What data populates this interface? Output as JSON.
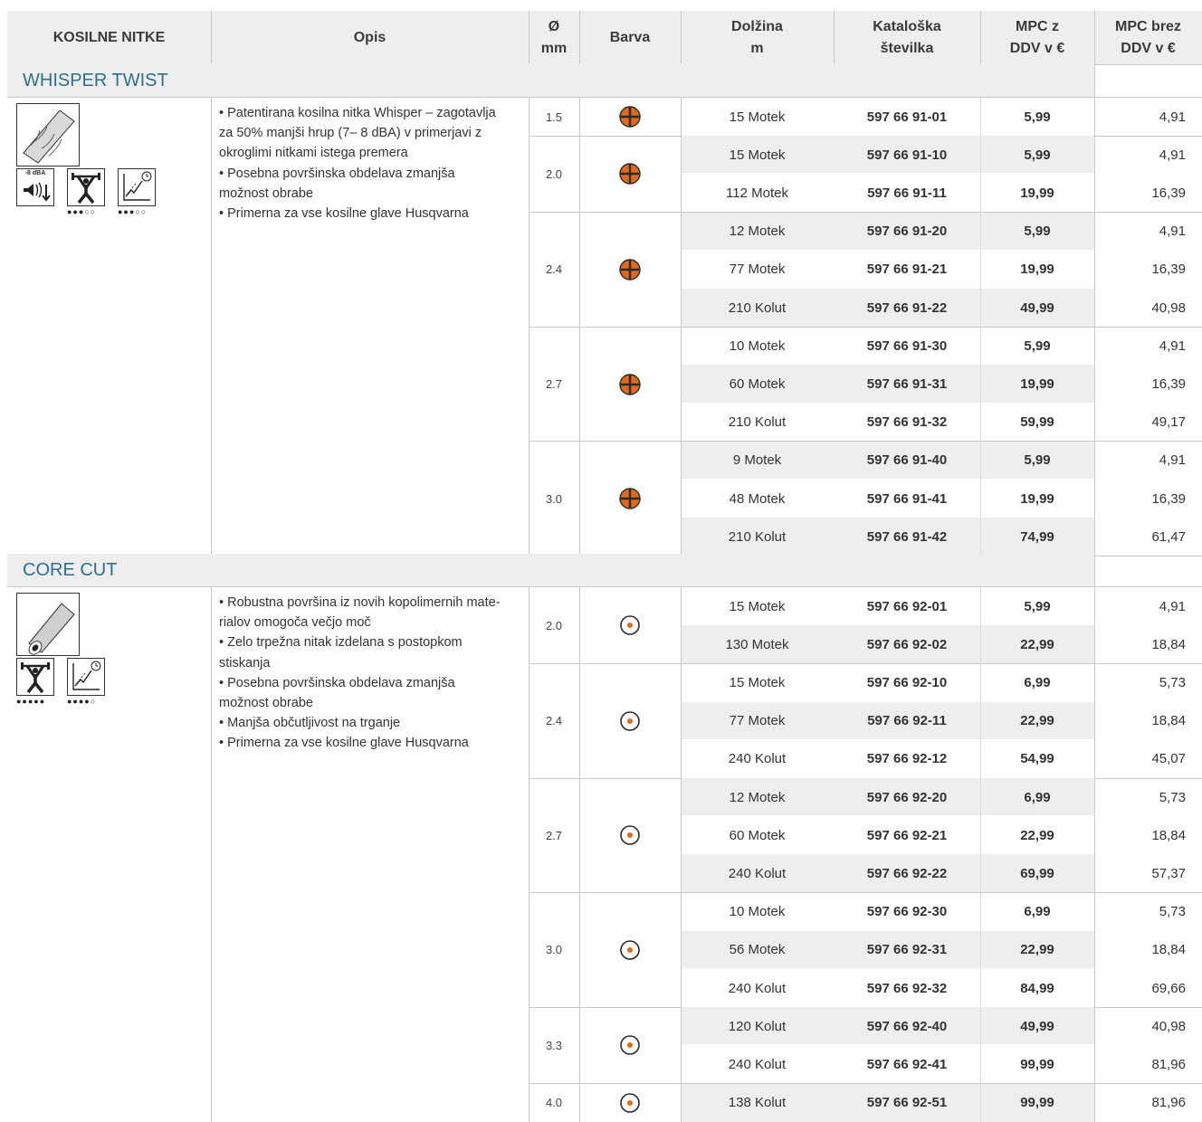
{
  "headers": {
    "name": "KOSILNE NITKE",
    "opis": "Opis",
    "diameter": "Ø\nmm",
    "barva": "Barva",
    "dolzina": "Dolžina\nm",
    "katalog": "Kataloška\nštevilka",
    "mpc_z": "MPC z\nDDV v €",
    "mpc_brez": "MPC brez\nDDV v €"
  },
  "colors": {
    "header_bg": "#eeeeee",
    "section_title": "#2e6f8e",
    "accent_orange": "#e06a1b"
  },
  "sections": [
    {
      "title": "WHISPER TWIST",
      "color_icon": "orange-cross-dot-icon",
      "product_icon": "twisted-line-icon",
      "feature_icons": [
        {
          "name": "noise-reduction-icon",
          "label": "-8 dBA",
          "rating": ""
        },
        {
          "name": "strength-icon",
          "label": "",
          "rating": "●●●○○"
        },
        {
          "name": "durability-graph-icon",
          "label": "",
          "rating": "●●●○○"
        }
      ],
      "description": [
        "• Patentirana kosilna nitka Whisper – zagotavlja\nza 50% manjši hrup  (7– 8 dBA) v primerjavi z\nokroglimi nitkami istega premera",
        "• Posebna površinska obdelava zmanjša\nmožnost obrabe",
        "• Primerna za vse kosilne glave  Husqvarna"
      ],
      "groups": [
        {
          "diameter": "1.5",
          "rows": [
            {
              "length": "15 Motek",
              "cat": "597 66 91-01",
              "mpc_z": "5,99",
              "mpc_brez": "4,91"
            }
          ]
        },
        {
          "diameter": "2.0",
          "rows": [
            {
              "length": "15 Motek",
              "cat": "597 66 91-10",
              "mpc_z": "5,99",
              "mpc_brez": "4,91"
            },
            {
              "length": "112 Motek",
              "cat": "597 66 91-11",
              "mpc_z": "19,99",
              "mpc_brez": "16,39"
            }
          ]
        },
        {
          "diameter": "2.4",
          "rows": [
            {
              "length": "12 Motek",
              "cat": "597 66 91-20",
              "mpc_z": "5,99",
              "mpc_brez": "4,91"
            },
            {
              "length": "77 Motek",
              "cat": "597 66 91-21",
              "mpc_z": "19,99",
              "mpc_brez": "16,39"
            },
            {
              "length": "210 Kolut",
              "cat": "597 66 91-22",
              "mpc_z": "49,99",
              "mpc_brez": "40,98"
            }
          ]
        },
        {
          "diameter": "2.7",
          "rows": [
            {
              "length": "10 Motek",
              "cat": "597 66 91-30",
              "mpc_z": "5,99",
              "mpc_brez": "4,91"
            },
            {
              "length": "60 Motek",
              "cat": "597 66 91-31",
              "mpc_z": "19,99",
              "mpc_brez": "16,39"
            },
            {
              "length": "210 Kolut",
              "cat": "597 66 91-32",
              "mpc_z": "59,99",
              "mpc_brez": "49,17"
            }
          ]
        },
        {
          "diameter": "3.0",
          "rows": [
            {
              "length": "9 Motek",
              "cat": "597 66 91-40",
              "mpc_z": "5,99",
              "mpc_brez": "4,91"
            },
            {
              "length": "48 Motek",
              "cat": "597 66 91-41",
              "mpc_z": "19,99",
              "mpc_brez": "16,39"
            },
            {
              "length": "210 Kolut",
              "cat": "597 66 91-42",
              "mpc_z": "74,99",
              "mpc_brez": "61,47"
            }
          ]
        }
      ]
    },
    {
      "title": "CORE CUT",
      "color_icon": "orange-core-dot-icon",
      "product_icon": "round-core-line-icon",
      "feature_icons": [
        {
          "name": "strength-icon",
          "label": "",
          "rating": "●●●●●"
        },
        {
          "name": "durability-graph-icon",
          "label": "",
          "rating": "●●●●○"
        }
      ],
      "description": [
        "• Robustna površina iz novih kopolimernih mate-\nrialov omogoča večjo moč",
        "• Zelo trpežna nitak izdelana s postopkom\nstiskanja",
        "• Posebna površinska obdelava zmanjša\nmožnost obrabe",
        "• Manjša občutljivost na trganje",
        "• Primerna za vse kosilne glave  Husqvarna"
      ],
      "groups": [
        {
          "diameter": "2.0",
          "rows": [
            {
              "length": "15 Motek",
              "cat": "597 66 92-01",
              "mpc_z": "5,99",
              "mpc_brez": "4,91"
            },
            {
              "length": "130 Motek",
              "cat": "597 66 92-02",
              "mpc_z": "22,99",
              "mpc_brez": "18,84"
            }
          ]
        },
        {
          "diameter": "2.4",
          "rows": [
            {
              "length": "15 Motek",
              "cat": "597 66 92-10",
              "mpc_z": "6,99",
              "mpc_brez": "5,73"
            },
            {
              "length": "77 Motek",
              "cat": "597 66 92-11",
              "mpc_z": "22,99",
              "mpc_brez": "18,84"
            },
            {
              "length": "240 Kolut",
              "cat": "597 66 92-12",
              "mpc_z": "54,99",
              "mpc_brez": "45,07"
            }
          ]
        },
        {
          "diameter": "2.7",
          "rows": [
            {
              "length": "12 Motek",
              "cat": "597 66 92-20",
              "mpc_z": "6,99",
              "mpc_brez": "5,73"
            },
            {
              "length": "60 Motek",
              "cat": "597 66 92-21",
              "mpc_z": "22,99",
              "mpc_brez": "18,84"
            },
            {
              "length": "240 Kolut",
              "cat": "597 66 92-22",
              "mpc_z": "69,99",
              "mpc_brez": "57,37"
            }
          ]
        },
        {
          "diameter": "3.0",
          "rows": [
            {
              "length": "10 Motek",
              "cat": "597 66 92-30",
              "mpc_z": "6,99",
              "mpc_brez": "5,73"
            },
            {
              "length": "56 Motek",
              "cat": "597 66 92-31",
              "mpc_z": "22,99",
              "mpc_brez": "18,84"
            },
            {
              "length": "240 Kolut",
              "cat": "597 66 92-32",
              "mpc_z": "84,99",
              "mpc_brez": "69,66"
            }
          ]
        },
        {
          "diameter": "3.3",
          "rows": [
            {
              "length": "120 Kolut",
              "cat": "597 66 92-40",
              "mpc_z": "49,99",
              "mpc_brez": "40,98"
            },
            {
              "length": "240 Kolut",
              "cat": "597 66 92-41",
              "mpc_z": "99,99",
              "mpc_brez": "81,96"
            }
          ]
        },
        {
          "diameter": "4.0",
          "rows": [
            {
              "length": "138 Kolut",
              "cat": "597 66 92-51",
              "mpc_z": "99,99",
              "mpc_brez": "81,96"
            }
          ]
        }
      ]
    }
  ]
}
